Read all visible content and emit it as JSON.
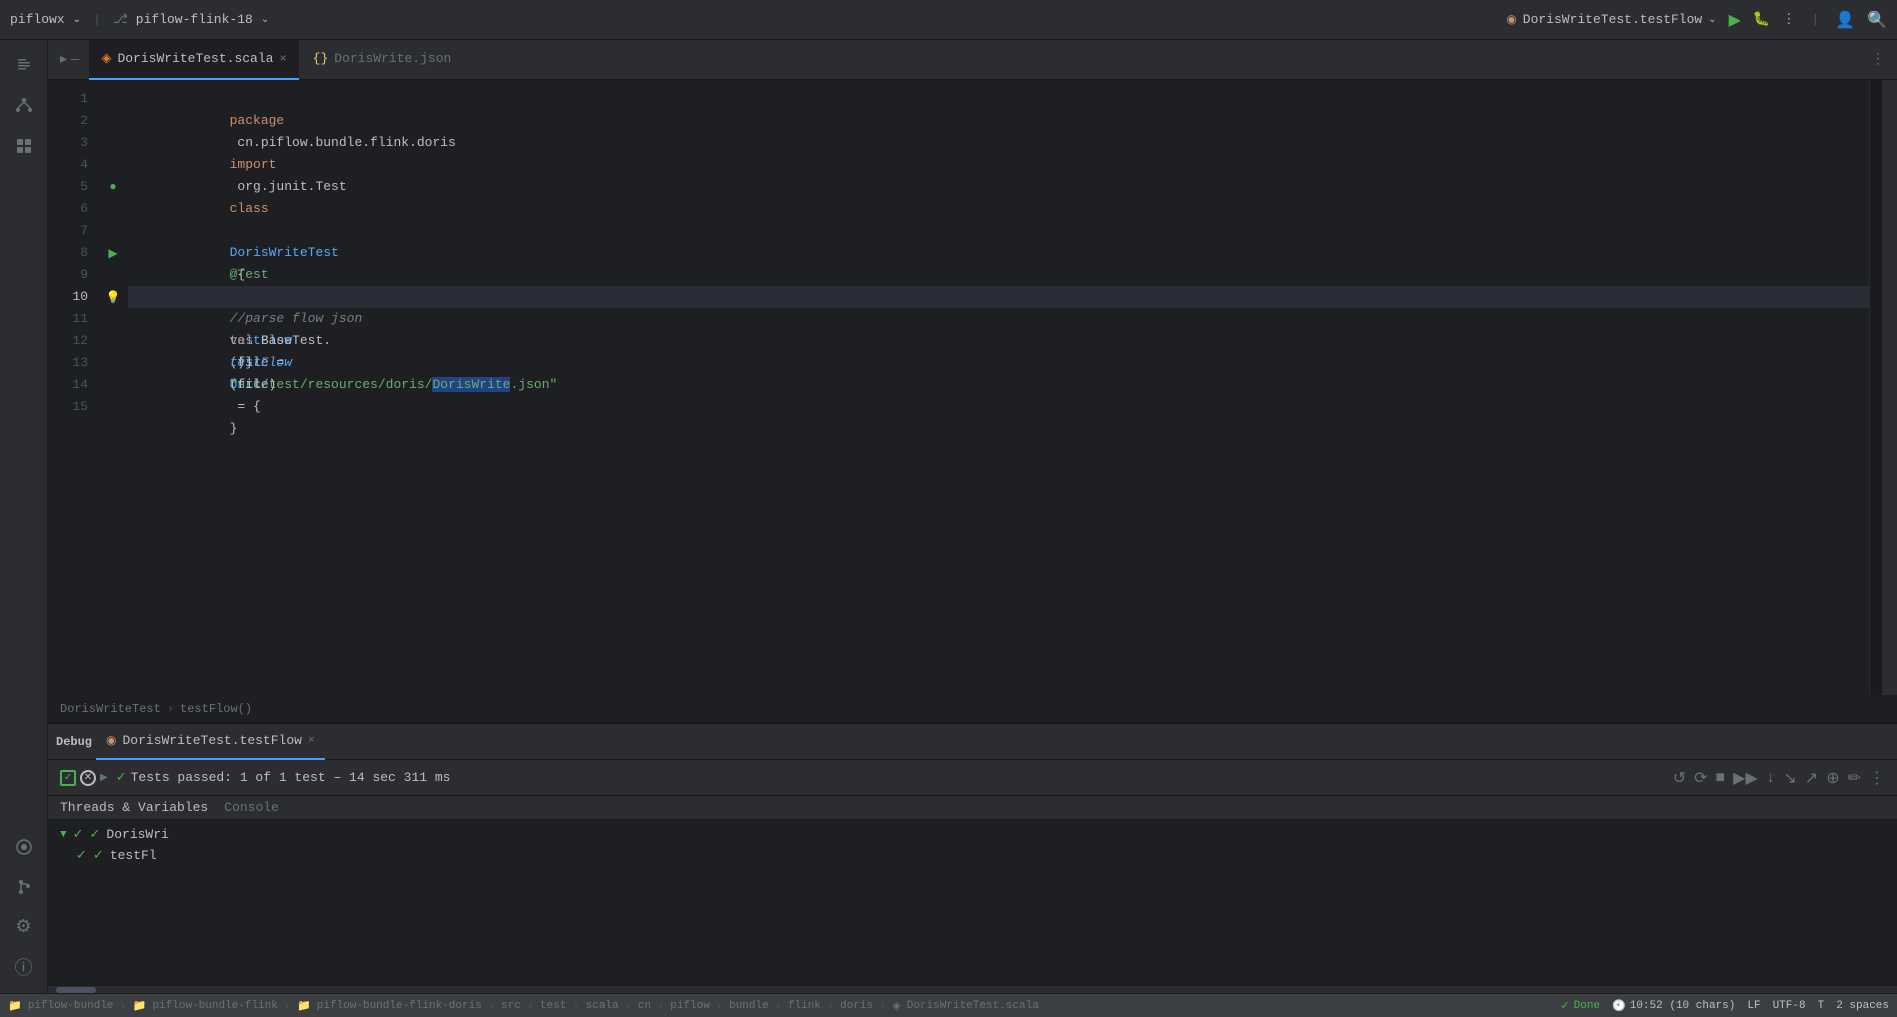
{
  "titlebar": {
    "app_name": "piflowx",
    "branch": "piflow-flink-18",
    "run_config": "DorisWriteTest.testFlow",
    "chevron": "⌄"
  },
  "tabs": {
    "active_tab": "DorisWriteTest.scala",
    "tabs": [
      {
        "id": "scala",
        "label": "DorisWriteTest.scala",
        "icon": "scala",
        "active": true
      },
      {
        "id": "json",
        "label": "DorisWrite.json",
        "icon": "json",
        "active": false
      }
    ]
  },
  "code": {
    "lines": [
      {
        "num": 1,
        "content": "package cn.piflow.bundle.flink.doris"
      },
      {
        "num": 2,
        "content": ""
      },
      {
        "num": 3,
        "content": "import org.junit.Test"
      },
      {
        "num": 4,
        "content": ""
      },
      {
        "num": 5,
        "content": "class DorisWriteTest {"
      },
      {
        "num": 6,
        "content": ""
      },
      {
        "num": 7,
        "content": "  @Test"
      },
      {
        "num": 8,
        "content": "  def testFlow(): Unit = {"
      },
      {
        "num": 9,
        "content": "    //parse flow json"
      },
      {
        "num": 10,
        "content": "    val file = \"src/test/resources/doris/DorisWrite.json\""
      },
      {
        "num": 11,
        "content": "    BaseTest.testFlow(file)"
      },
      {
        "num": 12,
        "content": "  }"
      },
      {
        "num": 13,
        "content": ""
      },
      {
        "num": 14,
        "content": ""
      },
      {
        "num": 15,
        "content": "}"
      }
    ]
  },
  "breadcrumb": {
    "items": [
      "DorisWriteTest",
      "testFlow()"
    ]
  },
  "debug_panel": {
    "tab_label": "DorisWriteTest.testFlow",
    "debug_label": "Debug",
    "threads_vars_label": "Threads & Variables",
    "console_label": "Console",
    "test_result": "Tests passed: 1 of 1 test – 14 sec 311 ms",
    "tree": [
      {
        "indent": 1,
        "label": "DorisWri",
        "has_check": true
      },
      {
        "indent": 2,
        "label": "testFl",
        "has_check": true
      }
    ]
  },
  "status_bar": {
    "breadcrumbs": [
      "piflow-bundle",
      "piflow-bundle-flink",
      "piflow-bundle-flink-doris",
      "src",
      "test",
      "scala",
      "cn",
      "piflow",
      "bundle",
      "flink",
      "doris",
      "DorisWriteTest.scala"
    ],
    "done": "Done",
    "time": "10:52 (10 chars)",
    "line_ending": "LF",
    "encoding": "UTF-8",
    "indent": "T",
    "spaces": "2 spaces"
  },
  "icons": {
    "run": "▶",
    "debug_run": "▶",
    "chevron_down": "⌄",
    "close": "×",
    "expand": "▶",
    "collapse": "▼",
    "check": "✓",
    "folder": "📁",
    "more_vert": "⋮",
    "more_horiz": "•••",
    "gear": "⚙",
    "person": "👤",
    "search": "🔍",
    "settings": "⚙",
    "branch": "⎇"
  }
}
